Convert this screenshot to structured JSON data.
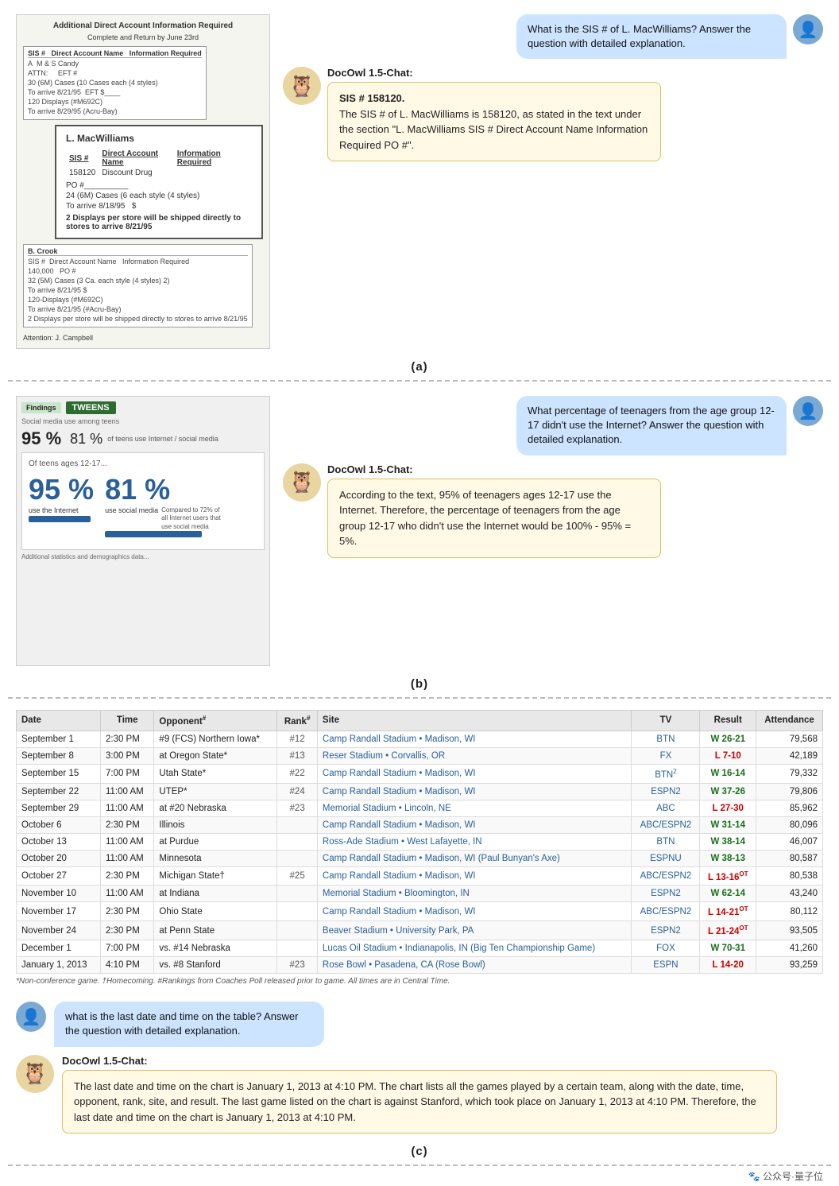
{
  "sections": {
    "a": {
      "label": "(a)",
      "doc": {
        "title": "Additional Direct Account Information Required",
        "subtitle": "Complete and Return by June 23rd",
        "people": [
          {
            "name": "L. MacWilliams",
            "sis_label": "SIS #",
            "sis_value": "158120",
            "account_label": "Direct Account Name",
            "account_value": "Discount Drug",
            "info_label": "Information Required",
            "po_label": "PO #",
            "line1": "24 (6M) Cases (6 each style (4 styles)",
            "line2": "To arrive 8/18/95   $",
            "line3": "2 Displays per store will be shipped directly to stores to arrive 8/21/95"
          }
        ],
        "attention": "Attention: J. Campbell"
      },
      "user_question": "What is the SIS # of L. MacWilliams? Answer the question with detailed explanation.",
      "bot_label": "DocOwl 1.5-Chat:",
      "bot_answer": "SIS # 158120.\nThe SIS # of L. MacWilliams is 158120, as stated in the text under the section \"L. MacWilliams SIS # Direct Account Name Information Required PO #\"."
    },
    "b": {
      "label": "(b)",
      "tweens": {
        "header": "Findings",
        "header2": "TWEENS",
        "stat1": "95 %",
        "stat2": "81 %",
        "bar_title": "Of teens ages 12-17...",
        "pct1": "95 %",
        "pct1_label": "use the Internet",
        "pct2": "81 %",
        "pct2_label": "use social media",
        "pct2_note": "Compared to 72% of all Internet users that use social media"
      },
      "user_question": "What percentage of teenagers from the age group 12-17 didn't use the Internet? Answer the question with detailed explanation.",
      "bot_label": "DocOwl 1.5-Chat:",
      "bot_answer": "According to the text, 95% of teenagers ages 12-17 use the Internet. Therefore, the percentage of teenagers from the age group 12-17 who didn't use the Internet would be 100% - 95% = 5%."
    },
    "c": {
      "label": "(c)",
      "table": {
        "headers": [
          "Date",
          "Time",
          "Opponent#",
          "Rank#",
          "Site",
          "TV",
          "Result",
          "Attendance"
        ],
        "rows": [
          [
            "September 1",
            "2:30 PM",
            "#9 (FCS) Northern Iowa*",
            "#12",
            "Camp Randall Stadium • Madison, WI",
            "BTN",
            "W 26-21",
            "79,568"
          ],
          [
            "September 8",
            "3:00 PM",
            "at Oregon State*",
            "#13",
            "Reser Stadium • Corvallis, OR",
            "FX",
            "L 7-10",
            "42,189"
          ],
          [
            "September 15",
            "7:00 PM",
            "Utah State*",
            "#22",
            "Camp Randall Stadium • Madison, WI",
            "BTN[2]",
            "W 16-14",
            "79,332"
          ],
          [
            "September 22",
            "11:00 AM",
            "UTEP*",
            "#24",
            "Camp Randall Stadium • Madison, WI",
            "ESPN2",
            "W 37-26",
            "79,806"
          ],
          [
            "September 29",
            "11:00 AM",
            "at #20 Nebraska",
            "#23",
            "Memorial Stadium • Lincoln, NE",
            "ABC",
            "L 27-30",
            "85,962"
          ],
          [
            "October 6",
            "2:30 PM",
            "Illinois",
            "",
            "Camp Randall Stadium • Madison, WI",
            "ABC/ESPN2",
            "W 31-14",
            "80,096"
          ],
          [
            "October 13",
            "11:00 AM",
            "at Purdue",
            "",
            "Ross-Ade Stadium • West Lafayette, IN",
            "BTN",
            "W 38-14",
            "46,007"
          ],
          [
            "October 20",
            "11:00 AM",
            "Minnesota",
            "",
            "Camp Randall Stadium • Madison, WI (Paul Bunyan's Axe)",
            "ESPNU",
            "W 38-13",
            "80,587"
          ],
          [
            "October 27",
            "2:30 PM",
            "Michigan State†",
            "#25",
            "Camp Randall Stadium • Madison, WI",
            "ABC/ESPN2",
            "L 13-16 OT",
            "80,538"
          ],
          [
            "November 10",
            "11:00 AM",
            "at Indiana",
            "",
            "Memorial Stadium • Bloomington, IN",
            "ESPN2",
            "W 62-14",
            "43,240"
          ],
          [
            "November 17",
            "2:30 PM",
            "Ohio State",
            "",
            "Camp Randall Stadium • Madison, WI",
            "ABC/ESPN2",
            "L 14-21 OT",
            "80,112"
          ],
          [
            "November 24",
            "2:30 PM",
            "at Penn State",
            "",
            "Beaver Stadium • University Park, PA",
            "ESPN2",
            "L 21-24 OT",
            "93,505"
          ],
          [
            "December 1",
            "7:00 PM",
            "vs. #14 Nebraska",
            "",
            "Lucas Oil Stadium • Indianapolis, IN (Big Ten Championship Game)",
            "FOX",
            "W 70-31",
            "41,260"
          ],
          [
            "January 1, 2013",
            "4:10 PM",
            "vs. #8 Stanford",
            "#23",
            "Rose Bowl • Pasadena, CA (Rose Bowl)",
            "ESPN",
            "L 14-20",
            "93,259"
          ]
        ],
        "footnote": "*Non-conference game. †Homecoming. #Rankings from Coaches Poll released prior to game. All times are in Central Time."
      },
      "user_question": "what is the last date and time on the table? Answer the question with detailed explanation.",
      "bot_label": "DocOwl 1.5-Chat:",
      "bot_answer": "The last date and time on the chart is January 1, 2013 at 4:10 PM. The chart lists all the games played by a certain team, along with the date, time, opponent, rank, site, and result. The last game listed on the chart is against Stanford, which took place on January 1, 2013 at 4:10 PM. Therefore, the last date and time on the chart is January 1, 2013 at 4:10 PM."
    }
  },
  "watermark": "🐾 公众号·量子位",
  "icons": {
    "user": "👤",
    "bot": "🦉"
  }
}
